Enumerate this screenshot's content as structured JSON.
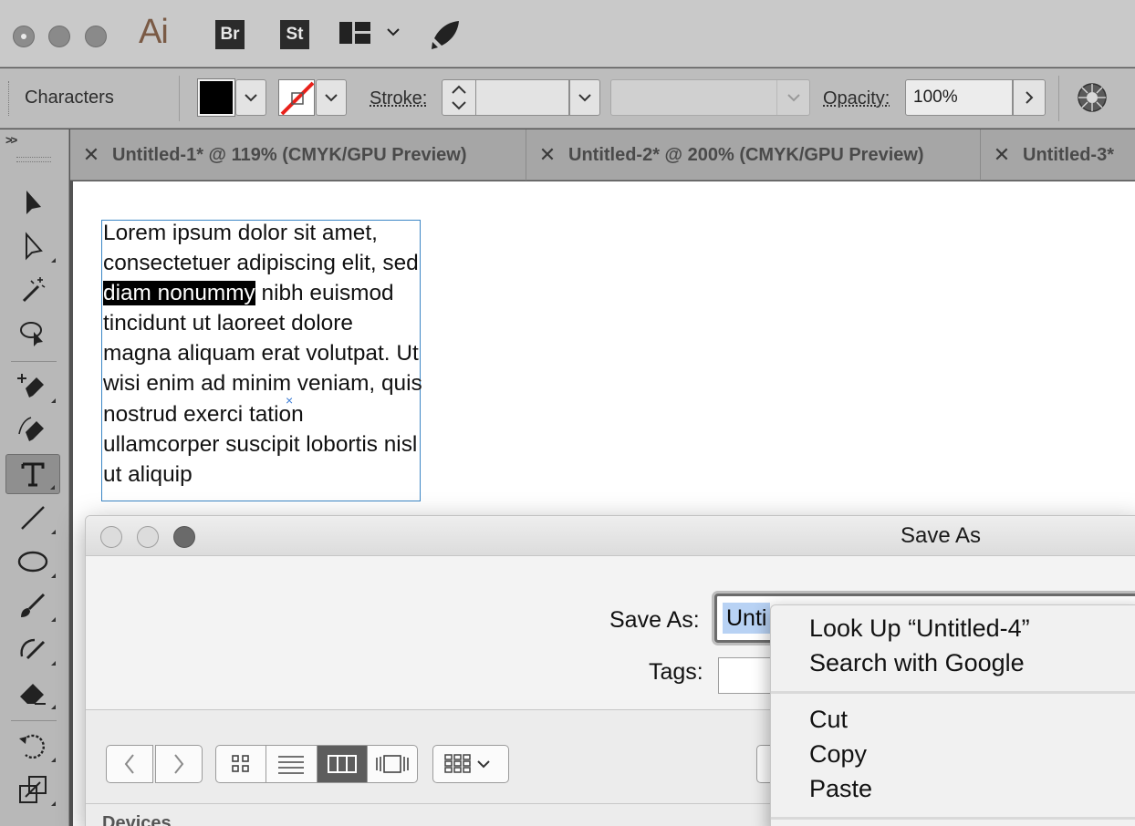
{
  "app": {
    "logo": "Ai",
    "bridge_label": "Br",
    "stock_label": "St"
  },
  "control_bar": {
    "context_label": "Characters",
    "stroke_label": "Stroke:",
    "opacity_label": "Opacity:",
    "opacity_value": "100%",
    "fill_color": "#000000"
  },
  "tabs": [
    {
      "label": "Untitled-1* @ 119% (CMYK/GPU Preview)"
    },
    {
      "label": "Untitled-2* @ 200% (CMYK/GPU Preview)"
    },
    {
      "label": "Untitled-3*"
    }
  ],
  "text_frame": {
    "before": "Lorem ipsum dolor sit amet, consectetuer adipiscing elit, sed ",
    "selected": "diam nonummy",
    "after": " nibh euismod tincidunt ut laoreet dolore magna aliquam erat volutpat. Ut wisi enim ad minim veniam, quis nostrud exerci tation ullamcorper suscipit lobortis nisl ut aliquip"
  },
  "save_dialog": {
    "title": "Save As",
    "save_as_label": "Save As:",
    "filename_visible": "Unti",
    "tags_label": "Tags:",
    "sidebar_heading": "Devices"
  },
  "context_menu": {
    "items": [
      "Look Up “Untitled-4”",
      "Search with Google",
      "Cut",
      "Copy",
      "Paste"
    ]
  },
  "colors": {
    "selection_highlight": "#b8d2f4",
    "text_frame_border": "#3b86c5",
    "stroke_none": "#e8211b"
  }
}
